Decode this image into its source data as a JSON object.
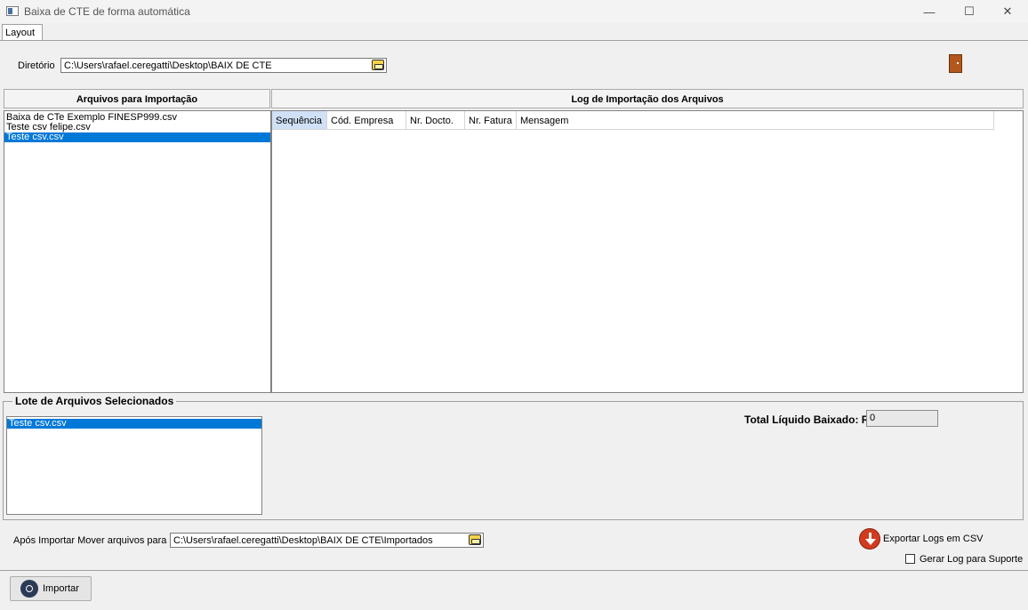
{
  "window": {
    "title": "Baixa de CTE de forma automática",
    "controls": {
      "minimize": "—",
      "maximize": "☐",
      "close": "✕"
    }
  },
  "tabs": [
    "Layout"
  ],
  "directory": {
    "label": "Diretório",
    "value": "C:\\Users\\rafael.ceregatti\\Desktop\\BAIX DE CTE",
    "browse_icon": "folder-icon"
  },
  "exit_icon": "exit-door-icon",
  "files_panel": {
    "header": "Arquivos para Importação",
    "items": [
      "Baixa de CTe Exemplo FINESP999.csv",
      "Teste csv felipe.csv",
      "Teste csv.csv"
    ],
    "selected_index": 2
  },
  "log_panel": {
    "header": "Log de Importação dos Arquivos",
    "columns": [
      "Sequência",
      "Cód. Empresa",
      "Nr. Docto.",
      "Nr. Fatura",
      "Mensagem"
    ],
    "active_column": 0,
    "rows": []
  },
  "batch": {
    "title": "Lote de Arquivos Selecionados",
    "items": [
      "Teste csv.csv"
    ],
    "selected_index": 0
  },
  "total": {
    "label": "Total Líquido Baixado: R$",
    "value": "0"
  },
  "move": {
    "label": "Após Importar Mover arquivos para :",
    "value": "C:\\Users\\rafael.ceregatti\\Desktop\\BAIX DE CTE\\Importados",
    "browse_icon": "folder-icon"
  },
  "export": {
    "label": "Exportar Logs em CSV",
    "icon": "download-arrow-icon",
    "color": "#d13b1f"
  },
  "support": {
    "label": "Gerar Log para Suporte",
    "checked": false
  },
  "import_button": {
    "label": "Importar",
    "icon": "gear-icon"
  },
  "colors": {
    "selection": "#0078d7",
    "active_column": "#cfe0f7",
    "window_bg": "#f0f0f0"
  }
}
